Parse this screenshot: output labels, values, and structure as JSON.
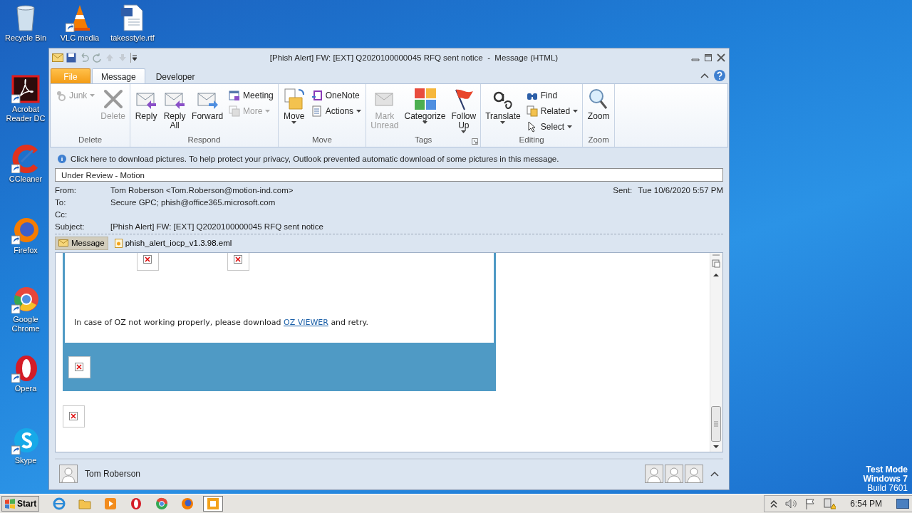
{
  "desktop_icons": [
    {
      "label": "Recycle Bin"
    },
    {
      "label": "VLC media"
    },
    {
      "label": "takesstyle.rtf"
    },
    {
      "label": "Acrobat Reader DC"
    },
    {
      "label": "CCleaner"
    },
    {
      "label": "Firefox"
    },
    {
      "label": "Google Chrome"
    },
    {
      "label": "Opera"
    },
    {
      "label": "Skype"
    }
  ],
  "window": {
    "title": "[Phish Alert] FW: [EXT] Q2020100000045 RFQ sent notice  -  Message (HTML)",
    "tabs": [
      {
        "label": "File",
        "kind": "file",
        "selected": false
      },
      {
        "label": "Message",
        "kind": "tab",
        "selected": true
      },
      {
        "label": "Developer",
        "kind": "tab",
        "selected": false
      }
    ],
    "ribbon": [
      {
        "label": "Delete",
        "launcher": false,
        "items": [
          {
            "label": "Junk",
            "kind": "small",
            "disabled": true,
            "dropdown": true
          },
          {
            "label": "Delete",
            "kind": "large",
            "disabled": true,
            "dropdown": false
          }
        ]
      },
      {
        "label": "Respond",
        "launcher": false,
        "items": [
          {
            "label": "Reply",
            "kind": "large",
            "disabled": false,
            "dropdown": false
          },
          {
            "label": "Reply All",
            "kind": "large",
            "disabled": false,
            "dropdown": false
          },
          {
            "label": "Forward",
            "kind": "large",
            "disabled": false,
            "dropdown": false
          },
          {
            "label": "Meeting",
            "kind": "small",
            "disabled": false,
            "dropdown": false
          },
          {
            "label": "More",
            "kind": "small",
            "disabled": true,
            "dropdown": true
          }
        ]
      },
      {
        "label": "Move",
        "launcher": false,
        "items": [
          {
            "label": "Move",
            "kind": "large",
            "disabled": false,
            "dropdown": true
          },
          {
            "label": "OneNote",
            "kind": "small",
            "disabled": false,
            "dropdown": false
          },
          {
            "label": "Actions",
            "kind": "small",
            "disabled": false,
            "dropdown": true
          }
        ]
      },
      {
        "label": "Tags",
        "launcher": true,
        "items": [
          {
            "label": "Mark Unread",
            "kind": "large",
            "disabled": true,
            "dropdown": false
          },
          {
            "label": "Categorize",
            "kind": "large",
            "disabled": false,
            "dropdown": true
          },
          {
            "label": "Follow Up",
            "kind": "large",
            "disabled": false,
            "dropdown": true
          }
        ]
      },
      {
        "label": "Editing",
        "launcher": false,
        "items": [
          {
            "label": "Translate",
            "kind": "large",
            "disabled": false,
            "dropdown": true
          },
          {
            "label": "Find",
            "kind": "small",
            "disabled": false,
            "dropdown": false
          },
          {
            "label": "Related",
            "kind": "small",
            "disabled": false,
            "dropdown": true
          },
          {
            "label": "Select",
            "kind": "small",
            "disabled": false,
            "dropdown": true
          }
        ]
      },
      {
        "label": "Zoom",
        "launcher": false,
        "items": [
          {
            "label": "Zoom",
            "kind": "large",
            "disabled": false,
            "dropdown": false
          }
        ]
      }
    ],
    "info_bar": "Click here to download pictures. To help protect your privacy, Outlook prevented automatic download of some pictures in this message.",
    "category": "Under Review - Motion",
    "header": [
      {
        "label": "From:",
        "value": "Tom Roberson <Tom.Roberson@motion-ind.com>"
      },
      {
        "label": "To:",
        "value": "Secure GPC; phish@office365.microsoft.com"
      },
      {
        "label": "Cc:"
      },
      {
        "label": "Subject:",
        "value": "[Phish Alert] FW: [EXT] Q2020100000045 RFQ sent notice"
      }
    ],
    "sent": {
      "label": "Sent:",
      "value": "Tue 10/6/2020 5:57 PM"
    },
    "attachments": [
      {
        "label": "Message",
        "selected": true
      },
      {
        "label": "phish_alert_iocp_v1.3.98.eml",
        "selected": false
      }
    ],
    "body": {
      "before": "In case of OZ not working properly, please download",
      "link": "OZ VIEWER",
      "after": "and retry."
    },
    "people_pane": {
      "name": "Tom Roberson"
    }
  },
  "desktop_notice": [
    "Test Mode",
    "Windows 7",
    "Build 7601"
  ],
  "taskbar": {
    "start": "Start",
    "apps": [
      {
        "selected": false
      },
      {
        "selected": false
      },
      {
        "selected": false
      },
      {
        "selected": false
      },
      {
        "selected": false
      },
      {
        "selected": false
      },
      {
        "selected": true
      }
    ],
    "clock": "6:54 PM"
  }
}
